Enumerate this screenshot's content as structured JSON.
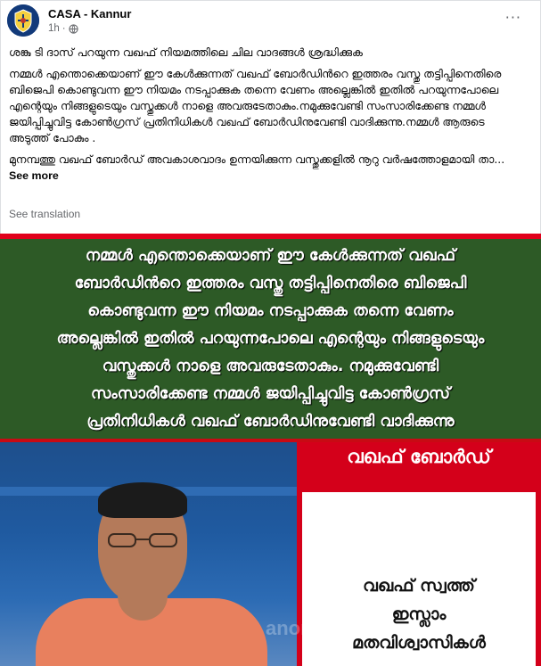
{
  "post": {
    "author": "CASA - Kannur",
    "time": "1h",
    "separator": "·",
    "more_label": "···",
    "paragraphs": [
      "ശങ്കു ടി ദാസ് പറയുന്ന വഖഫ് നിയമത്തിലെ ചില വാദങ്ങൾ ശ്രദ്ധിക്കുക",
      "നമ്മൾ എന്തൊക്കെയാണ് ഈ കേൾക്കുന്നത് വഖഫ് ബോർഡിൻറെ ഇത്തരം വസ്തു തട്ടിപ്പിനെതിരെ ബിജെപി കൊണ്ടുവന്ന ഈ നിയമം നടപ്പാക്കുക തന്നെ വേണം അല്ലെങ്കിൽ ഇതിൽ പറയുന്നപോലെ എന്റെയും നിങ്ങളുടെയും വസ്തുക്കൾ നാളെ അവരുടേതാകും.നമുക്കുവേണ്ടി സംസാരിക്കേണ്ട നമ്മൾ ജയിപ്പിച്ചുവിട്ട കോൺഗ്രസ് പ്രതിനിധികൾ വഖഫ് ബോർഡിനുവേണ്ടി വാദിക്കുന്നു.നമ്മൾ ആരുടെ അടുത്ത് പോകും ."
    ],
    "truncated_text": "മുനമ്പത്തു വഖഫ് ബോർഡ് അവകാശവാദം ഉന്നയിക്കുന്ന വസ്തുക്കളിൽ നൂറു വർഷത്തോളമായി താ...",
    "see_more": "See more",
    "see_translation": "See translation"
  },
  "image": {
    "banner_lines": [
      "നമ്മൾ എന്തൊക്കെയാണ് ഈ കേൾക്കുന്നത് വഖഫ്",
      "ബോർഡിൻറെ ഇത്തരം വസ്തു തട്ടിപ്പിനെതിരെ ബിജെപി",
      "കൊണ്ടുവന്ന ഈ നിയമം നടപ്പാക്കുക തന്നെ വേണം",
      "അല്ലെങ്കിൽ ഇതിൽ പറയുന്നപോലെ എന്റെയും നിങ്ങളുടെയും",
      "വസ്തുക്കൾ നാളെ അവരുടേതാകും. നമുക്കുവേണ്ടി",
      "സംസാരിക്കേണ്ട നമ്മൾ ജയിപ്പിച്ചുവിട്ട കോൺഗ്രസ്",
      "പ്രതിനിധികൾ വഖഫ് ബോർഡിനുവേണ്ടി വാദിക്കുന്നു"
    ],
    "card_title": "വഖഫ് ബോർഡ്",
    "card_lines": [
      "വഖഫ് സ്വത്ത്",
      "ഇസ്ലാം",
      "മതവിശ്വാസികൾ"
    ],
    "watermark": "anorama"
  },
  "colors": {
    "banner_green": "#2d5a26",
    "news_red": "#d4001a",
    "link_gray": "#65676b"
  }
}
